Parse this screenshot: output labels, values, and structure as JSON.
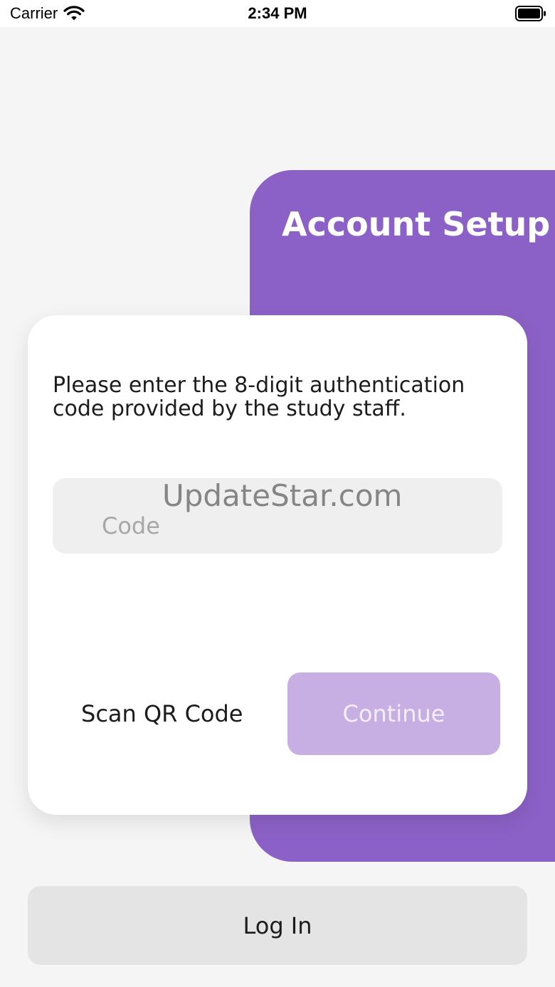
{
  "status_bar": {
    "carrier": "Carrier",
    "time": "2:34 PM",
    "icons": [
      "wifi-icon",
      "battery-icon"
    ]
  },
  "header": {
    "title": "Account Setup"
  },
  "auth_card": {
    "instructions": "Please enter the 8-digit authentication code provided by the study staff.",
    "code_field": {
      "value": "",
      "placeholder": "Code"
    },
    "watermark": "UpdateStar.com",
    "scan_button_label": "Scan QR Code",
    "continue_button_label": "Continue"
  },
  "login_button_label": "Log In",
  "colors": {
    "accent": "#8c61c7",
    "continue_disabled": "#c7aee3",
    "background": "#f5f5f5",
    "field": "#efefef",
    "login_button": "#e4e4e4"
  }
}
